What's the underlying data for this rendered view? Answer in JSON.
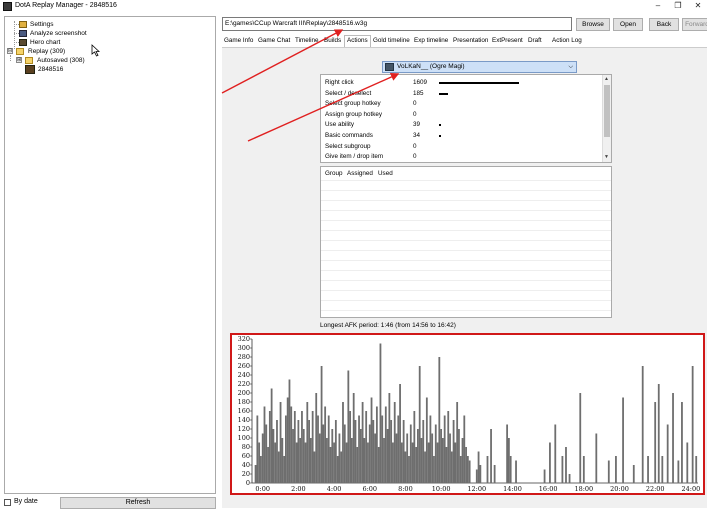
{
  "window": {
    "title": "DotA Replay Manager - 2848516",
    "icons": {
      "app": "app-icon",
      "minimize": "minimize-icon",
      "restore": "restore-icon",
      "close": "close-icon"
    }
  },
  "tree": {
    "items": [
      {
        "label": "Settings",
        "icon": "settings-icon"
      },
      {
        "label": "Analyze screenshot",
        "icon": "screenshot-icon"
      },
      {
        "label": "Hero chart",
        "icon": "hero-chart-icon"
      },
      {
        "label": "Replay (309)",
        "icon": "folder-icon",
        "toggle": "⊟"
      },
      {
        "label": "Autosaved (308)",
        "icon": "folder-icon",
        "toggle": "⊞"
      },
      {
        "label": "2848516",
        "icon": "replay-icon"
      }
    ]
  },
  "bottom": {
    "by_date_label": "By date",
    "refresh_label": "Refresh"
  },
  "toolbar": {
    "path_value": "E:\\games\\CCup Warcraft III\\Replay\\2848516.w3g",
    "browse_label": "Browse",
    "open_label": "Open",
    "back_label": "Back",
    "forward_label": "Forward"
  },
  "tabs": [
    {
      "label": "Game Info"
    },
    {
      "label": "Game Chat"
    },
    {
      "label": "Timeline"
    },
    {
      "label": "Builds"
    },
    {
      "label": "Actions",
      "active": true
    },
    {
      "label": "Gold timeline"
    },
    {
      "label": "Exp timeline"
    },
    {
      "label": "Presentation"
    },
    {
      "label": "ExtPresent"
    },
    {
      "label": "Draft"
    },
    {
      "label": "Action Log"
    }
  ],
  "hero_select": {
    "value": "VoLKaN__ (Ogre Magi)"
  },
  "action_stats": [
    {
      "label": "Right click",
      "value": "1609",
      "fraction": 1.0
    },
    {
      "label": "Select / deselect",
      "value": "185",
      "fraction": 0.115
    },
    {
      "label": "Select group hotkey",
      "value": "0",
      "fraction": 0
    },
    {
      "label": "Assign group hotkey",
      "value": "0",
      "fraction": 0
    },
    {
      "label": "Use ability",
      "value": "39",
      "fraction": 0.024
    },
    {
      "label": "Basic commands",
      "value": "34",
      "fraction": 0.021
    },
    {
      "label": "Select subgroup",
      "value": "0",
      "fraction": 0
    },
    {
      "label": "Give item / drop item",
      "value": "0",
      "fraction": 0
    }
  ],
  "group_table": {
    "columns": [
      "Group",
      "Assigned",
      "Used"
    ]
  },
  "afk_text": "Longest AFK period: 1:46 (from 14:56 to 16:42)",
  "colors": {
    "highlight_border": "#d01818",
    "arrow": "#e02020",
    "bars": "#6e6e6e"
  },
  "chart_data": {
    "type": "bar",
    "ylim": [
      0,
      320
    ],
    "y_ticks": [
      "0",
      "20",
      "40",
      "60",
      "80",
      "100",
      "120",
      "140",
      "160",
      "180",
      "200",
      "220",
      "240",
      "260",
      "280",
      "300",
      "320"
    ],
    "x_ticks": [
      "0:00",
      "2:00",
      "4:00",
      "6:00",
      "8:00",
      "10:00",
      "12:00",
      "14:00",
      "16:00",
      "18:00",
      "20:00",
      "22:00",
      "24:00"
    ],
    "x_max_minutes": 25,
    "bars": [
      [
        0.2,
        40
      ],
      [
        0.3,
        150
      ],
      [
        0.4,
        90
      ],
      [
        0.5,
        60
      ],
      [
        0.6,
        110
      ],
      [
        0.7,
        170
      ],
      [
        0.8,
        130
      ],
      [
        0.9,
        80
      ],
      [
        1.0,
        160
      ],
      [
        1.1,
        210
      ],
      [
        1.2,
        120
      ],
      [
        1.3,
        90
      ],
      [
        1.4,
        140
      ],
      [
        1.5,
        70
      ],
      [
        1.6,
        180
      ],
      [
        1.7,
        100
      ],
      [
        1.8,
        60
      ],
      [
        1.9,
        150
      ],
      [
        2.0,
        190
      ],
      [
        2.1,
        230
      ],
      [
        2.2,
        170
      ],
      [
        2.3,
        120
      ],
      [
        2.4,
        160
      ],
      [
        2.5,
        90
      ],
      [
        2.6,
        140
      ],
      [
        2.7,
        100
      ],
      [
        2.8,
        160
      ],
      [
        2.9,
        120
      ],
      [
        3.0,
        90
      ],
      [
        3.1,
        180
      ],
      [
        3.2,
        140
      ],
      [
        3.3,
        100
      ],
      [
        3.4,
        160
      ],
      [
        3.5,
        70
      ],
      [
        3.6,
        200
      ],
      [
        3.7,
        150
      ],
      [
        3.8,
        110
      ],
      [
        3.9,
        260
      ],
      [
        4.0,
        130
      ],
      [
        4.1,
        170
      ],
      [
        4.2,
        100
      ],
      [
        4.3,
        150
      ],
      [
        4.4,
        80
      ],
      [
        4.5,
        120
      ],
      [
        4.6,
        90
      ],
      [
        4.7,
        140
      ],
      [
        4.8,
        60
      ],
      [
        4.9,
        110
      ],
      [
        5.0,
        70
      ],
      [
        5.1,
        180
      ],
      [
        5.2,
        130
      ],
      [
        5.3,
        90
      ],
      [
        5.4,
        250
      ],
      [
        5.5,
        160
      ],
      [
        5.6,
        100
      ],
      [
        5.7,
        200
      ],
      [
        5.8,
        140
      ],
      [
        5.9,
        80
      ],
      [
        6.0,
        150
      ],
      [
        6.1,
        120
      ],
      [
        6.2,
        180
      ],
      [
        6.3,
        100
      ],
      [
        6.4,
        160
      ],
      [
        6.5,
        90
      ],
      [
        6.6,
        130
      ],
      [
        6.7,
        190
      ],
      [
        6.8,
        140
      ],
      [
        6.9,
        110
      ],
      [
        7.0,
        170
      ],
      [
        7.1,
        80
      ],
      [
        7.2,
        310
      ],
      [
        7.3,
        150
      ],
      [
        7.4,
        100
      ],
      [
        7.5,
        170
      ],
      [
        7.6,
        120
      ],
      [
        7.7,
        200
      ],
      [
        7.8,
        140
      ],
      [
        7.9,
        90
      ],
      [
        8.0,
        180
      ],
      [
        8.1,
        110
      ],
      [
        8.2,
        150
      ],
      [
        8.3,
        220
      ],
      [
        8.4,
        90
      ],
      [
        8.5,
        140
      ],
      [
        8.6,
        70
      ],
      [
        8.7,
        110
      ],
      [
        8.8,
        60
      ],
      [
        8.9,
        130
      ],
      [
        9.0,
        90
      ],
      [
        9.1,
        160
      ],
      [
        9.2,
        80
      ],
      [
        9.3,
        120
      ],
      [
        9.4,
        260
      ],
      [
        9.5,
        100
      ],
      [
        9.6,
        140
      ],
      [
        9.7,
        70
      ],
      [
        9.8,
        190
      ],
      [
        9.9,
        90
      ],
      [
        10.0,
        150
      ],
      [
        10.1,
        110
      ],
      [
        10.2,
        60
      ],
      [
        10.3,
        130
      ],
      [
        10.4,
        90
      ],
      [
        10.5,
        280
      ],
      [
        10.6,
        120
      ],
      [
        10.7,
        100
      ],
      [
        10.8,
        150
      ],
      [
        10.9,
        80
      ],
      [
        11.0,
        160
      ],
      [
        11.1,
        110
      ],
      [
        11.2,
        70
      ],
      [
        11.3,
        140
      ],
      [
        11.4,
        90
      ],
      [
        11.5,
        180
      ],
      [
        11.6,
        120
      ],
      [
        11.7,
        60
      ],
      [
        11.8,
        100
      ],
      [
        11.9,
        150
      ],
      [
        12.0,
        80
      ],
      [
        12.1,
        60
      ],
      [
        12.2,
        50
      ],
      [
        12.6,
        30
      ],
      [
        12.7,
        70
      ],
      [
        12.8,
        40
      ],
      [
        13.2,
        60
      ],
      [
        13.4,
        120
      ],
      [
        13.6,
        40
      ],
      [
        14.3,
        130
      ],
      [
        14.4,
        100
      ],
      [
        14.5,
        60
      ],
      [
        14.8,
        50
      ],
      [
        16.4,
        30
      ],
      [
        16.7,
        90
      ],
      [
        17.0,
        130
      ],
      [
        17.4,
        60
      ],
      [
        17.6,
        80
      ],
      [
        17.8,
        20
      ],
      [
        18.4,
        200
      ],
      [
        18.6,
        60
      ],
      [
        19.3,
        110
      ],
      [
        20.0,
        50
      ],
      [
        20.4,
        60
      ],
      [
        20.8,
        190
      ],
      [
        21.4,
        40
      ],
      [
        21.9,
        260
      ],
      [
        22.2,
        60
      ],
      [
        22.6,
        180
      ],
      [
        22.8,
        220
      ],
      [
        23.0,
        60
      ],
      [
        23.3,
        130
      ],
      [
        23.6,
        200
      ],
      [
        23.9,
        50
      ],
      [
        24.1,
        180
      ],
      [
        24.4,
        90
      ],
      [
        24.7,
        260
      ],
      [
        24.9,
        60
      ]
    ]
  }
}
